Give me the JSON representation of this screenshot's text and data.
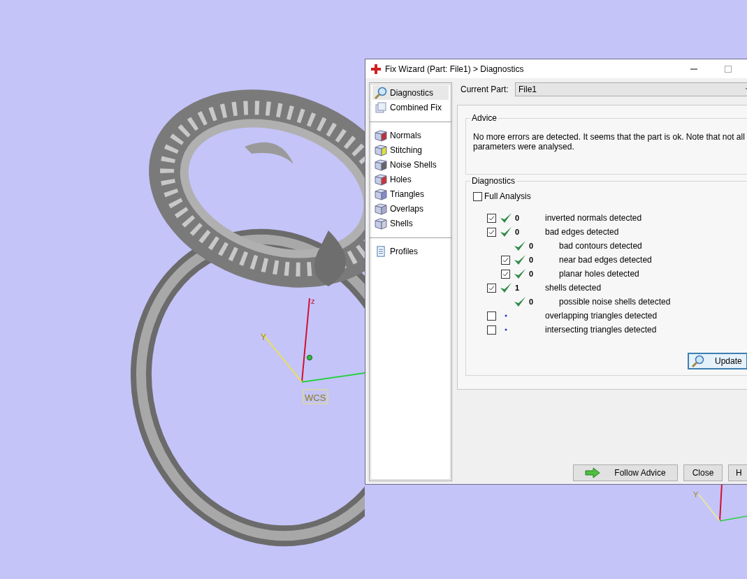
{
  "viewport": {
    "axis_labels": [
      {
        "text": "z"
      },
      {
        "text": "Y"
      },
      {
        "text": "WCS"
      },
      {
        "text": "Y"
      }
    ]
  },
  "dialog": {
    "title": "Fix Wizard (Part: File1) > Diagnostics",
    "nav_groups": [
      [
        {
          "label": "Diagnostics",
          "selected": true
        },
        {
          "label": "Combined Fix",
          "selected": false
        }
      ],
      [
        {
          "label": "Normals",
          "selected": false
        },
        {
          "label": "Stitching",
          "selected": false
        },
        {
          "label": "Noise Shells",
          "selected": false
        },
        {
          "label": "Holes",
          "selected": false
        },
        {
          "label": "Triangles",
          "selected": false
        },
        {
          "label": "Overlaps",
          "selected": false
        },
        {
          "label": "Shells",
          "selected": false
        }
      ],
      [
        {
          "label": "Profiles",
          "selected": false
        }
      ]
    ],
    "current_part": {
      "label": "Current Part:",
      "value": "File1"
    },
    "advice": {
      "title": "Advice",
      "text": "No more errors are detected. It seems that the part is ok. Note that not all parameters were analysed."
    },
    "diagnostics": {
      "title": "Diagnostics",
      "full_analysis": {
        "label": "Full Analysis",
        "checked": false
      },
      "rows": [
        {
          "kind": "checkbox",
          "checked": true,
          "passed": true,
          "count": "0",
          "label": "inverted normals detected"
        },
        {
          "kind": "checkbox",
          "checked": true,
          "passed": true,
          "count": "0",
          "label": "bad edges detected",
          "children": [
            {
              "kind": "plain",
              "passed": true,
              "count": "0",
              "label": "bad contours detected"
            },
            {
              "kind": "checkbox",
              "checked": true,
              "passed": true,
              "count": "0",
              "label": "near bad edges detected"
            },
            {
              "kind": "checkbox",
              "checked": true,
              "passed": true,
              "count": "0",
              "label": "planar holes detected"
            }
          ]
        },
        {
          "kind": "checkbox",
          "checked": true,
          "passed": true,
          "count": "1",
          "label": "shells detected",
          "children": [
            {
              "kind": "plain",
              "passed": true,
              "count": "0",
              "label": "possible noise shells detected"
            }
          ]
        },
        {
          "kind": "checkbox",
          "checked": false,
          "passed": false,
          "label": "overlapping triangles detected"
        },
        {
          "kind": "checkbox",
          "checked": false,
          "passed": false,
          "label": "intersecting triangles detected"
        }
      ],
      "update_button": "Update"
    },
    "buttons": [
      {
        "kind": "follow",
        "label": "Follow Advice"
      },
      {
        "kind": "close",
        "label": "Close"
      },
      {
        "kind": "help",
        "label": "H"
      }
    ]
  }
}
